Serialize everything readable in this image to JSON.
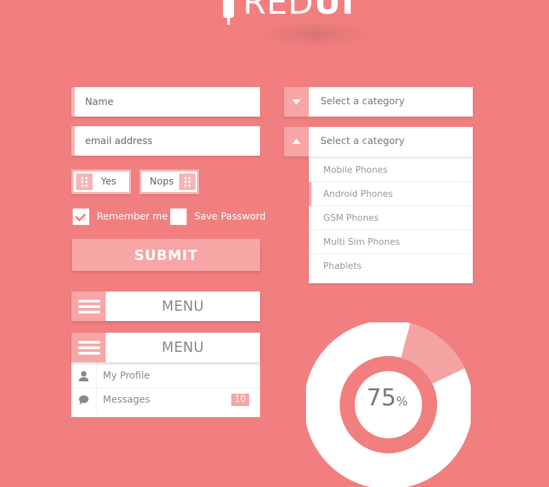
{
  "logo": {
    "text_thin": "RED",
    "text_bold": "UI"
  },
  "form": {
    "name_placeholder": "Name",
    "email_placeholder": "email address",
    "toggle_yes": "Yes",
    "toggle_no": "Nops",
    "remember_label": "Remember me",
    "remember_checked": true,
    "save_password_label": "Save Password",
    "save_password_checked": false,
    "submit_label": "SUBMIT"
  },
  "menus": [
    {
      "title": "MENU",
      "icon": "hamburger-icon"
    },
    {
      "title": "MENU",
      "icon": "hamburger-icon",
      "items": [
        {
          "label": "My Profile",
          "icon": "user-icon"
        },
        {
          "label": "Messages",
          "icon": "chat-bubble-icon",
          "badge": "10"
        }
      ]
    }
  ],
  "selects": [
    {
      "label": "Select a category",
      "state": "collapsed",
      "icon": "triangle-down-icon"
    },
    {
      "label": "Select a category",
      "state": "expanded",
      "icon": "triangle-up-icon",
      "options": [
        "Mobile Phones",
        "Android Phones",
        "GSM Phones",
        "Multi Sim Phones",
        "Phablets"
      ],
      "highlighted_option": "Android Phones"
    }
  ],
  "progress": {
    "value_text": "75",
    "unit": "%",
    "fraction": 0.75
  },
  "colors": {
    "background": "#f27f7f",
    "accent": "#f8a5a5",
    "accent_light": "#f8b4b4",
    "white": "#ffffff"
  }
}
